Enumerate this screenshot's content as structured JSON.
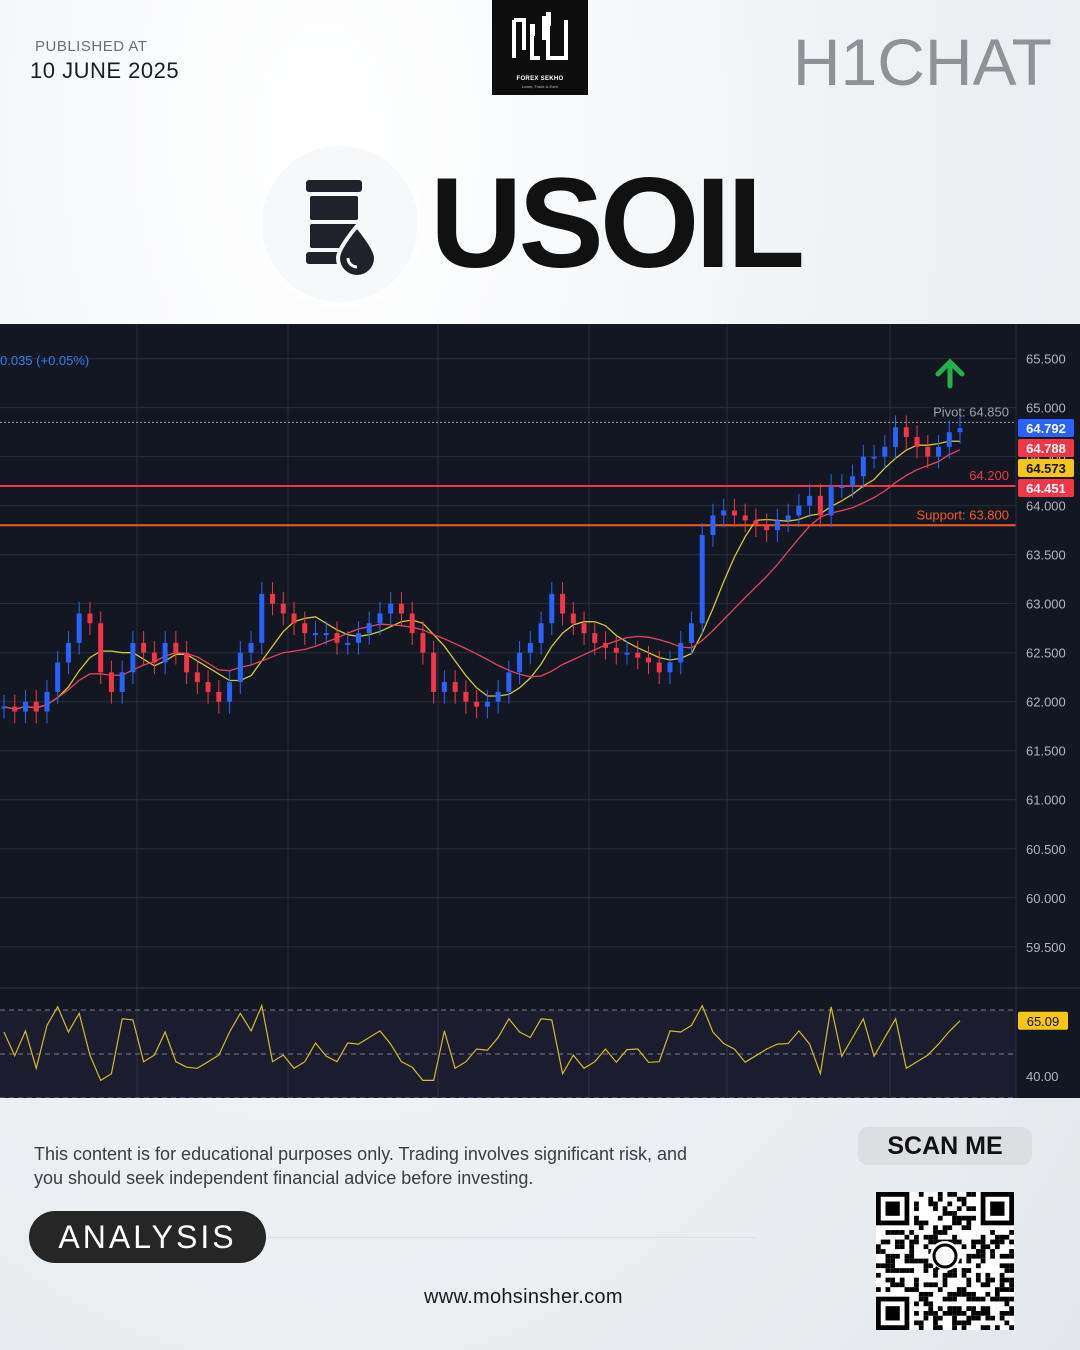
{
  "header": {
    "published_label": "PUBLISHED AT",
    "published_date": "10 JUNE 2025",
    "logo_text": "FOREX SEKHO",
    "logo_subtext": "Learn, Trade & Earn",
    "brand": "H1CHAT"
  },
  "hero": {
    "symbol": "USOIL",
    "icon": "oil-barrel-icon"
  },
  "chart_data": {
    "type": "candlestick",
    "change_text": "0.035 (+0.05%)",
    "price_ticks": [
      "65.500",
      "65.000",
      "64.500",
      "64.000",
      "63.500",
      "63.000",
      "62.500",
      "62.000",
      "61.500",
      "61.000",
      "60.500",
      "60.000",
      "59.500"
    ],
    "ylim": [
      59.1,
      65.7
    ],
    "levels": [
      {
        "label": "Pivot: 64.850",
        "value": 64.85,
        "color": "#9aa0aa"
      },
      {
        "label": "64.200",
        "value": 64.2,
        "color": "#f23645"
      },
      {
        "label": "Support: 63.800",
        "value": 63.8,
        "color": "#f05a28"
      }
    ],
    "price_badges": [
      {
        "text": "64.792",
        "value": 64.792,
        "color": "#2962ff"
      },
      {
        "text": "64.788",
        "value": 64.788,
        "color": "#f23645"
      },
      {
        "text": "64.573",
        "value": 64.573,
        "color": "#f5c518"
      },
      {
        "text": "64.451",
        "value": 64.451,
        "color": "#f23645"
      }
    ],
    "signal": "up-arrow",
    "close_series": [
      61.95,
      61.9,
      62.0,
      61.9,
      62.1,
      62.4,
      62.6,
      62.9,
      62.8,
      62.3,
      62.1,
      62.3,
      62.6,
      62.5,
      62.4,
      62.6,
      62.5,
      62.3,
      62.2,
      62.1,
      62.0,
      62.2,
      62.5,
      62.6,
      63.1,
      63.0,
      62.9,
      62.8,
      62.7,
      62.7,
      62.7,
      62.6,
      62.6,
      62.7,
      62.8,
      62.9,
      63.0,
      62.9,
      62.7,
      62.5,
      62.1,
      62.2,
      62.1,
      62.0,
      61.95,
      62.0,
      62.1,
      62.3,
      62.5,
      62.6,
      62.8,
      63.1,
      62.9,
      62.8,
      62.7,
      62.6,
      62.55,
      62.5,
      62.5,
      62.45,
      62.4,
      62.3,
      62.4,
      62.6,
      62.8,
      63.7,
      63.9,
      63.95,
      63.9,
      63.85,
      63.8,
      63.75,
      63.85,
      63.9,
      64.0,
      64.1,
      63.9,
      64.2,
      64.2,
      64.3,
      64.5,
      64.5,
      64.6,
      64.8,
      64.7,
      64.6,
      64.5,
      64.6,
      64.75,
      64.79
    ],
    "rsi": {
      "ticks": [
        "40.00"
      ],
      "badge": "65.09",
      "value": 65.09,
      "ylim": [
        30,
        80
      ]
    }
  },
  "footer": {
    "disclaimer": "This content is for educational purposes only. Trading involves significant risk, and you should seek independent financial advice before investing.",
    "tag": "ANALYSIS",
    "website": "www.mohsinsher.com",
    "scan_label": "SCAN ME"
  }
}
